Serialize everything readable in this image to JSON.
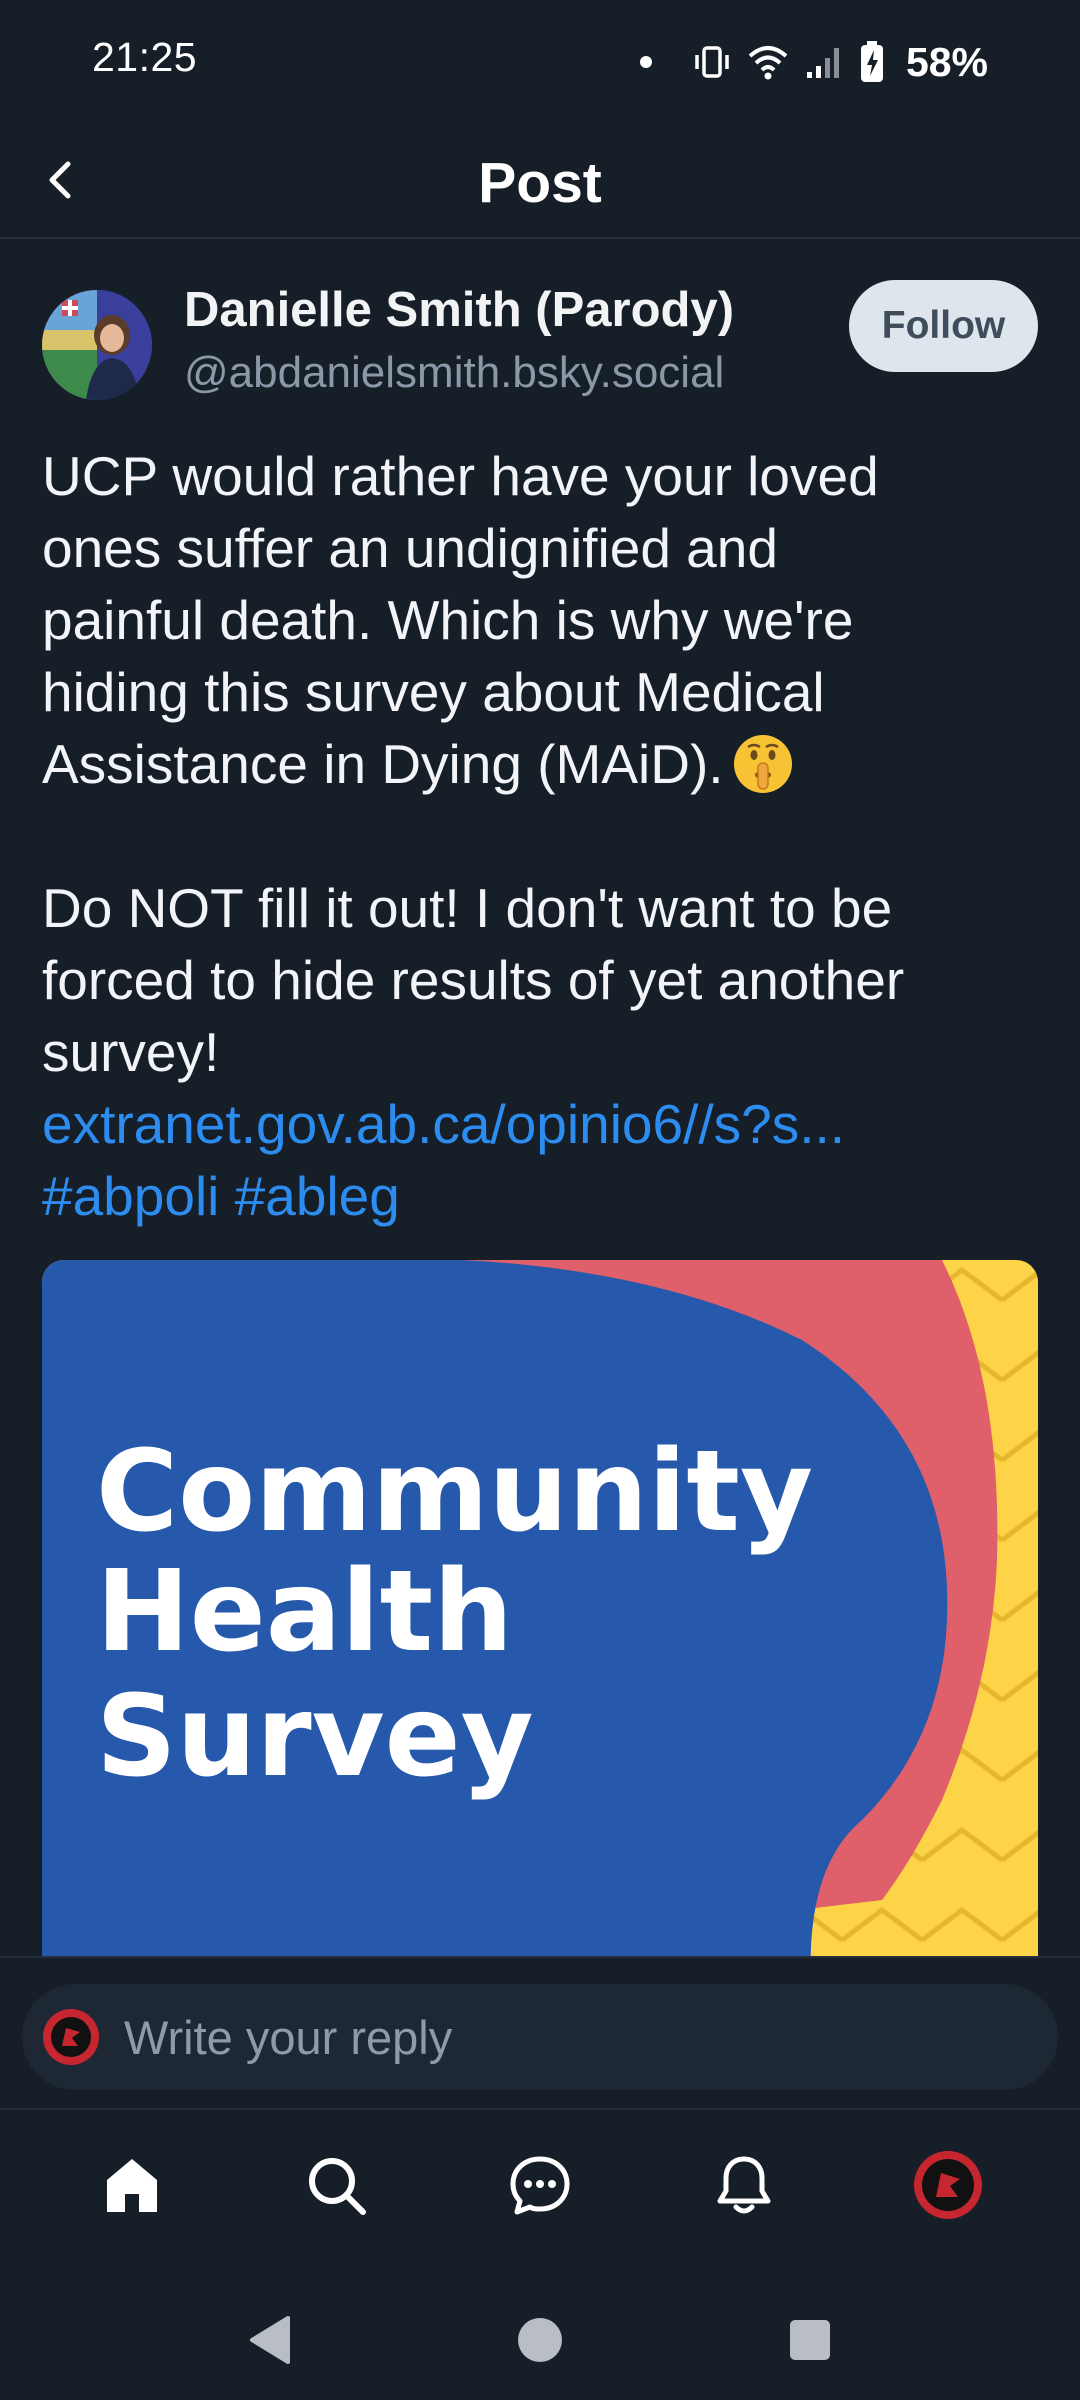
{
  "status_bar": {
    "time": "21:25",
    "battery": "58%",
    "icons": [
      "notification-dot-icon",
      "vibrate-icon",
      "wifi-icon",
      "signal-icon",
      "battery-charging-icon"
    ]
  },
  "header": {
    "title": "Post",
    "back_icon": "chevron-left-icon"
  },
  "post": {
    "author": {
      "display_name": "Danielle Smith (Parody)",
      "handle": "@abdanielsmith.bsky.social"
    },
    "follow_label": "Follow",
    "text_lines": [
      "UCP would rather have your loved",
      "ones suffer an undignified and",
      "painful death. Which is why we're",
      "hiding this survey about Medical",
      "Assistance in Dying (MAiD)."
    ],
    "emoji": "shushing-face-emoji",
    "text_lines_2": [
      "Do NOT fill it out! I don't want to be",
      "forced to hide results of yet another",
      "survey!"
    ],
    "link": "extranet.gov.ab.ca/opinio6//s?s...",
    "hashtags": [
      "#abpoli",
      "#ableg"
    ],
    "image": {
      "lines": [
        "Community",
        "Health",
        "Survey"
      ],
      "colors": {
        "blue": "#2658ac",
        "red": "#df5f6a",
        "yellow": "#fdd347"
      }
    }
  },
  "reply": {
    "placeholder": "Write your reply"
  },
  "bottom_nav": {
    "items": [
      "home-icon",
      "search-icon",
      "chat-icon",
      "bell-icon",
      "profile-avatar"
    ]
  },
  "system_nav": {
    "items": [
      "back-triangle-icon",
      "home-circle-icon",
      "recents-square-icon"
    ]
  },
  "colors": {
    "background": "#161e27",
    "link": "#2d8cf0",
    "follow_bg": "#dfe5ec"
  }
}
